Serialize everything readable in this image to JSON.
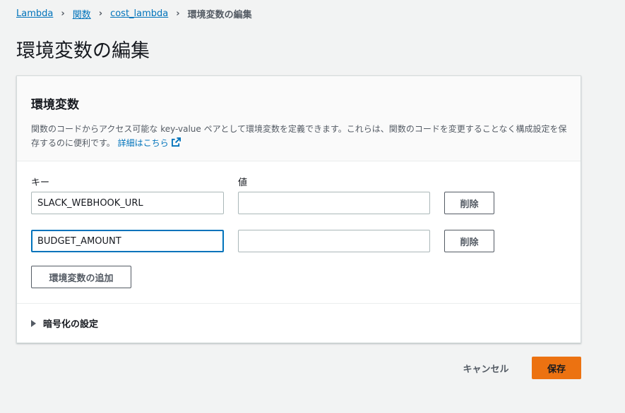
{
  "breadcrumb": {
    "items": [
      "Lambda",
      "関数",
      "cost_lambda"
    ],
    "current": "環境変数の編集"
  },
  "page_title": "環境変数の編集",
  "panel": {
    "title": "環境変数",
    "description": "関数のコードからアクセス可能な key-value ペアとして環境変数を定義できます。これらは、関数のコードを変更することなく構成設定を保存するのに便利です。",
    "learn_more": "詳細はこちら",
    "key_label": "キー",
    "value_label": "値",
    "rows": [
      {
        "key": "SLACK_WEBHOOK_URL",
        "value": "",
        "remove_label": "削除"
      },
      {
        "key": "BUDGET_AMOUNT",
        "value": "",
        "remove_label": "削除"
      }
    ],
    "add_label": "環境変数の追加",
    "encryption_label": "暗号化の設定"
  },
  "footer": {
    "cancel_label": "キャンセル",
    "save_label": "保存"
  },
  "colors": {
    "link": "#0073bb",
    "primary": "#ec7211",
    "focus": "#0073bb"
  }
}
